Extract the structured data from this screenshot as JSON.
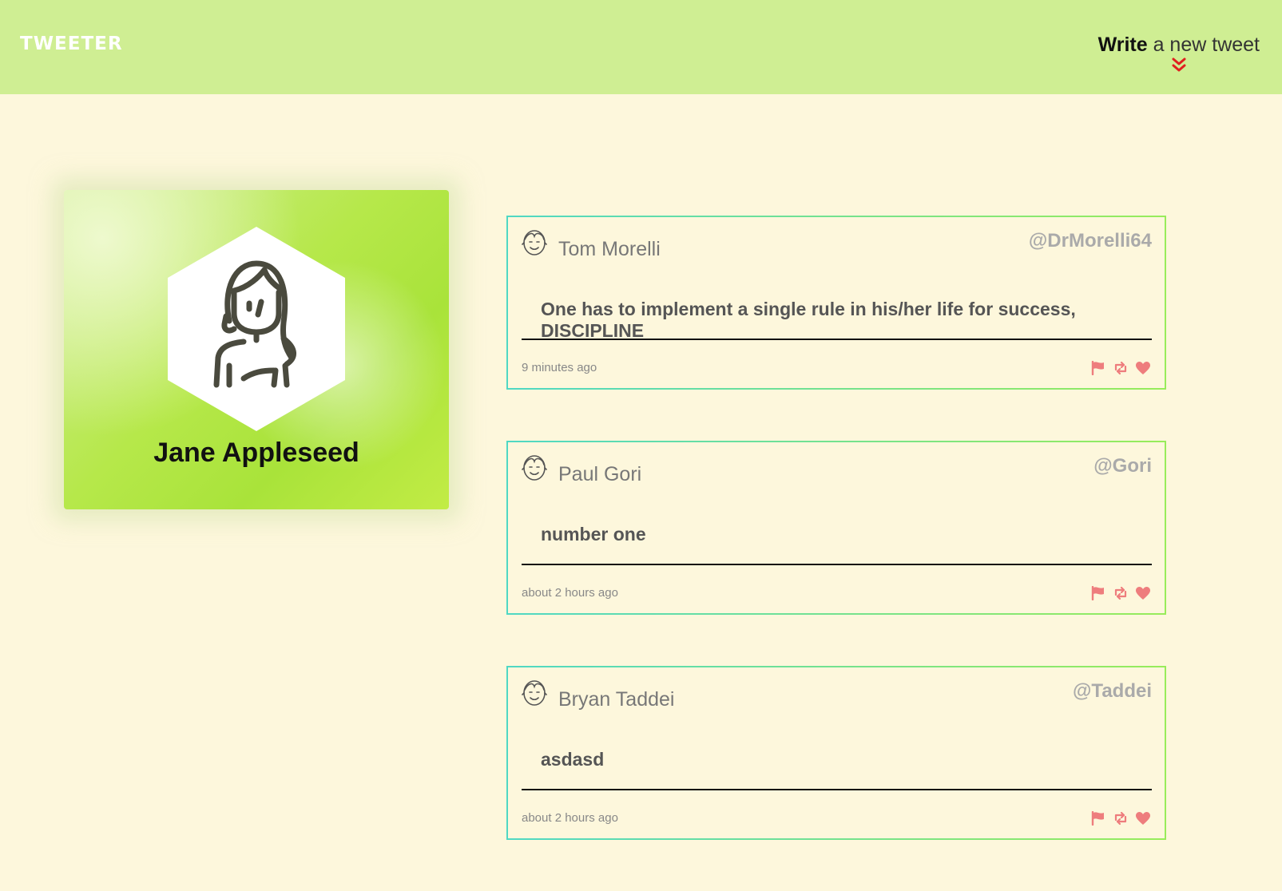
{
  "header": {
    "logo": "TWEETER",
    "compose_strong": "Write",
    "compose_rest": " a new tweet",
    "compose_icon": "double-chevron-down-icon"
  },
  "profile": {
    "name": "Jane Appleseed",
    "avatar": "woman-avatar-icon"
  },
  "colors": {
    "header_bg": "#cfee93",
    "page_bg": "#fdf7dc",
    "action_icons": "#ee7d7d",
    "chevron": "#e02020"
  },
  "tweets": [
    {
      "author": "Tom Morelli",
      "handle": "@DrMorelli64",
      "text": "One has to implement a single rule in his/her life for success, DISCIPLINE",
      "time": "9 minutes ago"
    },
    {
      "author": "Paul Gori",
      "handle": "@Gori",
      "text": "number one",
      "time": "about 2 hours ago"
    },
    {
      "author": "Bryan Taddei",
      "handle": "@Taddei",
      "text": "asdasd",
      "time": "about 2 hours ago"
    }
  ]
}
